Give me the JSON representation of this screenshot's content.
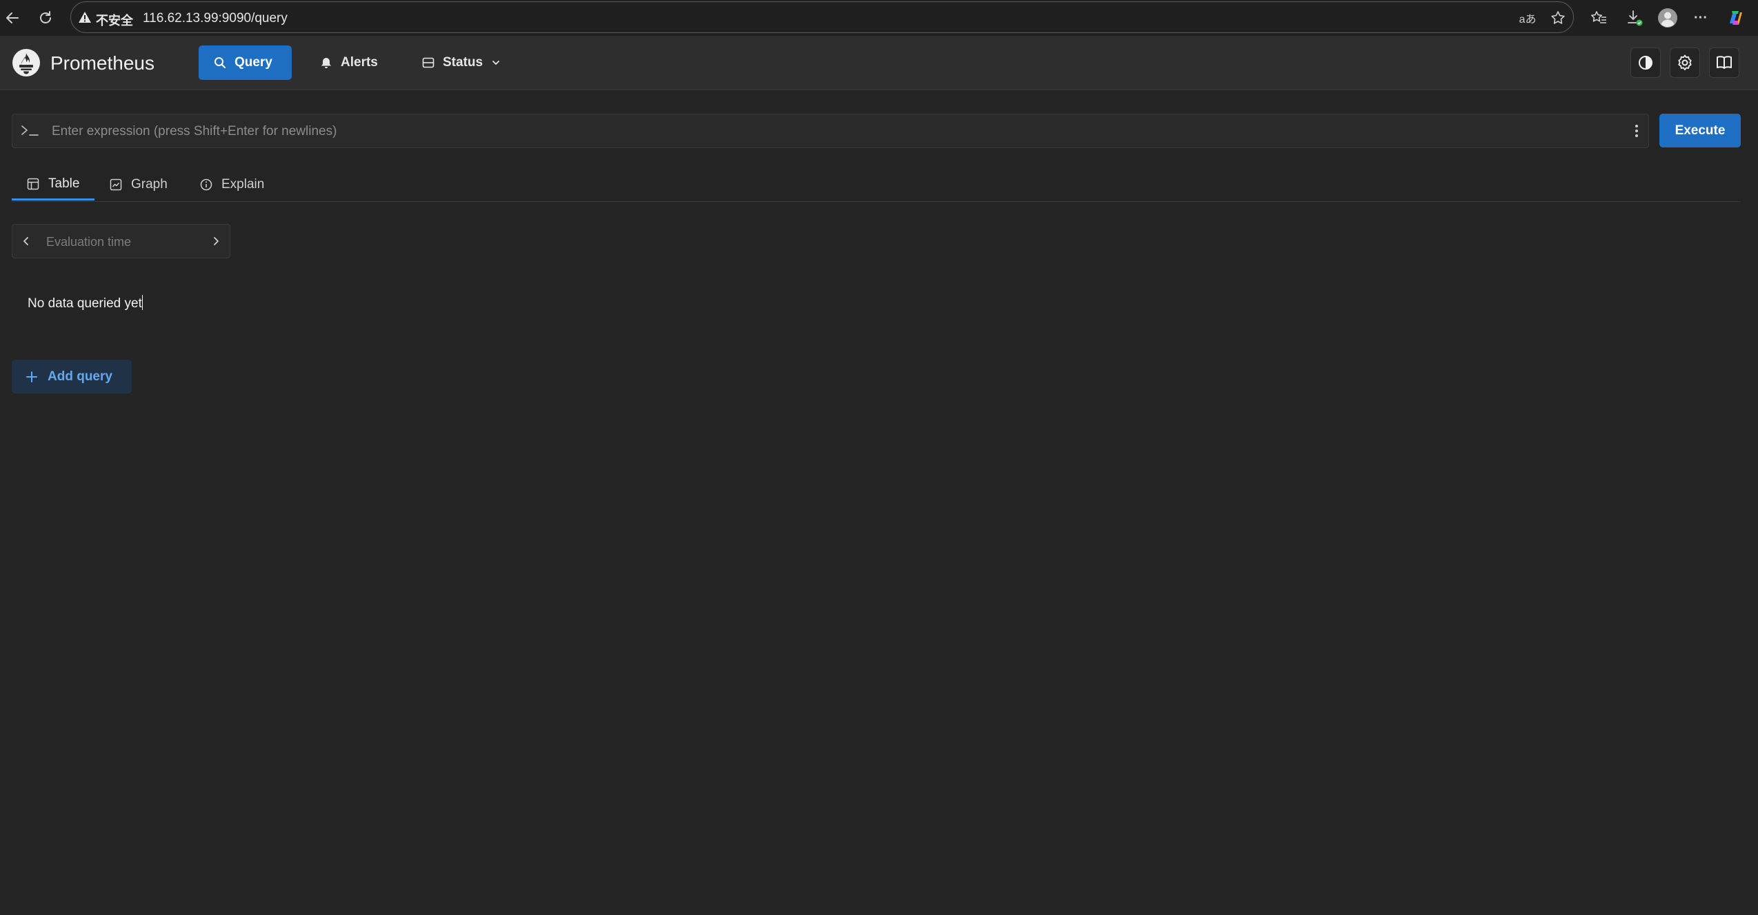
{
  "browser": {
    "security_label": "不安全",
    "url": "116.62.13.99:9090/query",
    "icons": [
      "back-icon",
      "reload-icon",
      "warning-icon",
      "translate-icon",
      "star-icon",
      "favorites-icon",
      "download-icon",
      "profile-icon",
      "more-icon",
      "copilot-icon"
    ],
    "translate_glyph": "aあ",
    "more_glyph": "···"
  },
  "app": {
    "brand": "Prometheus",
    "nav": {
      "query": "Query",
      "alerts": "Alerts",
      "status": "Status"
    },
    "header_icons": [
      "theme-toggle-icon",
      "settings-icon",
      "docs-book-icon"
    ]
  },
  "query": {
    "placeholder": "Enter expression (press Shift+Enter for newlines)",
    "value": "",
    "execute_label": "Execute"
  },
  "tabs": {
    "table": "Table",
    "graph": "Graph",
    "explain": "Explain",
    "active": "Table"
  },
  "evaluation": {
    "placeholder": "Evaluation time",
    "value": ""
  },
  "result": {
    "empty_message": "No data queried yet"
  },
  "actions": {
    "add_query": "Add query"
  },
  "colors": {
    "primary": "#1e6fc4",
    "background": "#242424",
    "header": "#2e2e2e",
    "tab_active": "#3a8ee6",
    "add_query_text": "#64a9f0"
  }
}
